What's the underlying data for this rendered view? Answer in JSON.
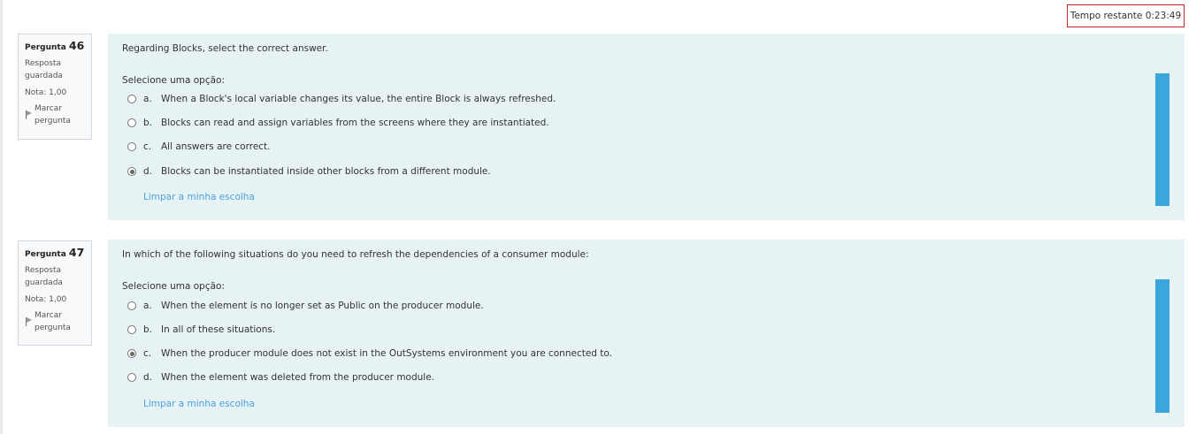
{
  "timer": {
    "label": "Tempo restante 0:23:49"
  },
  "questions": [
    {
      "label": "Pergunta",
      "number": "46",
      "state": "Resposta guardada",
      "grade": "Nota: 1,00",
      "flag": "Marcar pergunta",
      "text": "Regarding Blocks, select the correct answer.",
      "prompt": "Selecione uma opção:",
      "answers": [
        {
          "letter": "a.",
          "text": "When a Block's local variable changes its value, the entire Block is always refreshed.",
          "checked": false
        },
        {
          "letter": "b.",
          "text": "Blocks can read and assign variables from the screens where they are instantiated.",
          "checked": false
        },
        {
          "letter": "c.",
          "text": "All answers are correct.",
          "checked": false
        },
        {
          "letter": "d.",
          "text": "Blocks can be instantiated inside other blocks from a different module.",
          "checked": true
        }
      ],
      "clear": "Limpar a minha escolha"
    },
    {
      "label": "Pergunta",
      "number": "47",
      "state": "Resposta guardada",
      "grade": "Nota: 1,00",
      "flag": "Marcar pergunta",
      "text": "In which of the following situations do you need to refresh the dependencies of a consumer module:",
      "prompt": "Selecione uma opção:",
      "answers": [
        {
          "letter": "a.",
          "text": "When the element is no longer set as Public on the producer module.",
          "checked": false
        },
        {
          "letter": "b.",
          "text": "In all of these situations.",
          "checked": false
        },
        {
          "letter": "c.",
          "text": "When the producer module does not exist in the OutSystems environment you are connected to.",
          "checked": true
        },
        {
          "letter": "d.",
          "text": "When the element was deleted from the producer module.",
          "checked": false
        }
      ],
      "clear": "Limpar a minha escolha"
    }
  ]
}
